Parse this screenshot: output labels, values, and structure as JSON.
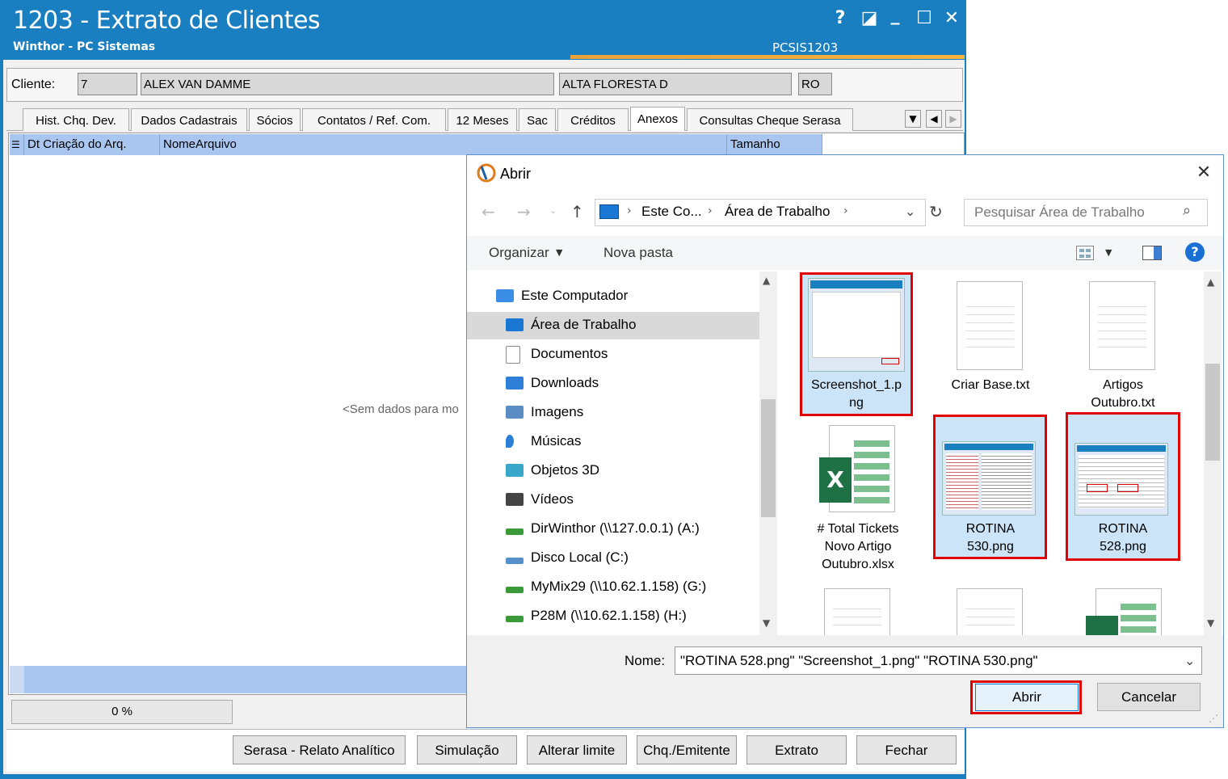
{
  "app": {
    "title": "1203 - Extrato de Clientes",
    "subtitle": "Winthor - PC Sistemas",
    "code": "PCSIS1203",
    "win_help": "?",
    "win_restore": "◪",
    "win_min": "_",
    "win_max": "☐",
    "win_close": "✕"
  },
  "client": {
    "label": "Cliente:",
    "code": "7",
    "name": "ALEX VAN DAMME",
    "city": "ALTA FLORESTA D",
    "state": "RO"
  },
  "tabs": [
    "Hist. Chq. Dev.",
    "Dados Cadastrais",
    "Sócios",
    "Contatos / Ref. Com.",
    "12 Meses",
    "Sac",
    "Créditos",
    "Anexos",
    "Consultas Cheque Serasa"
  ],
  "active_tab": "Anexos",
  "grid": {
    "columns": [
      "Dt Criação do Arq.",
      "NomeArquivo",
      "Tamanho"
    ],
    "empty_text": "<Sem dados para mo"
  },
  "progress": {
    "text": "0 %",
    "value": 0
  },
  "bottom_buttons": [
    "Serasa - Relato Analítico",
    "Simulação",
    "Alterar limite",
    "Chq./Emitente",
    "Extrato",
    "Fechar"
  ],
  "dialog": {
    "title": "Abrir",
    "breadcrumb": [
      "Este Co...",
      "Área de Trabalho"
    ],
    "search_placeholder": "Pesquisar Área de Trabalho",
    "organize": "Organizar",
    "new_folder": "Nova pasta",
    "nav": [
      {
        "label": "Este Computador",
        "icon": "computer-icon"
      },
      {
        "label": "Área de Trabalho",
        "icon": "desktop-icon"
      },
      {
        "label": "Documentos",
        "icon": "documents-icon"
      },
      {
        "label": "Downloads",
        "icon": "downloads-icon"
      },
      {
        "label": "Imagens",
        "icon": "images-icon"
      },
      {
        "label": "Músicas",
        "icon": "music-icon"
      },
      {
        "label": "Objetos 3D",
        "icon": "objects3d-icon"
      },
      {
        "label": "Vídeos",
        "icon": "videos-icon"
      },
      {
        "label": "DirWinthor (\\\\127.0.0.1) (A:)",
        "icon": "network-drive-icon"
      },
      {
        "label": "Disco Local (C:)",
        "icon": "local-disk-icon"
      },
      {
        "label": "MyMix29 (\\\\10.62.1.158) (G:)",
        "icon": "network-drive-icon"
      },
      {
        "label": "P28M (\\\\10.62.1.158) (H:)",
        "icon": "network-drive-icon"
      }
    ],
    "files": [
      {
        "name_l1": "Screenshot_1.p",
        "name_l2": "ng",
        "kind": "image",
        "selected": true
      },
      {
        "name_l1": "Criar Base.txt",
        "name_l2": "",
        "kind": "text",
        "selected": false
      },
      {
        "name_l1": "Artigos",
        "name_l2": "Outubro.txt",
        "kind": "text",
        "selected": false
      },
      {
        "name_l1": "# Total Tickets",
        "name_l2": "Novo Artigo",
        "name_l3": "Outubro.xlsx",
        "kind": "excel",
        "selected": false
      },
      {
        "name_l1": "ROTINA",
        "name_l2": "530.png",
        "kind": "image",
        "selected": true
      },
      {
        "name_l1": "ROTINA",
        "name_l2": "528.png",
        "kind": "image",
        "selected": true
      }
    ],
    "filename_label": "Nome:",
    "filename_value": "\"ROTINA 528.png\" \"Screenshot_1.png\" \"ROTINA 530.png\"",
    "open_button": "Abrir",
    "cancel_button": "Cancelar",
    "excel_letter": "X"
  }
}
